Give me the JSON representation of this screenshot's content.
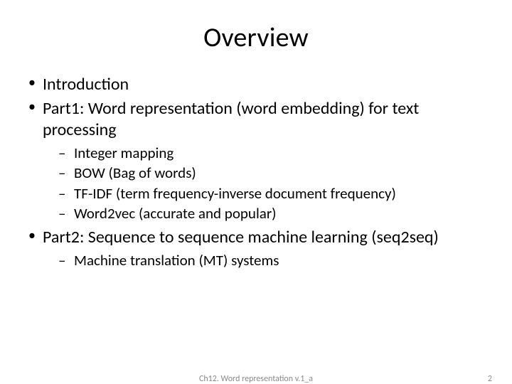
{
  "title": "Overview",
  "bullets": {
    "b1": "Introduction",
    "b2": "Part1: Word representation (word embedding) for text processing",
    "b2sub": {
      "s1": "Integer mapping",
      "s2": "BOW (Bag of words)",
      "s3": "TF-IDF (term frequency-inverse document frequency)",
      "s4": "Word2vec (accurate and popular)"
    },
    "b3": "Part2: Sequence to sequence machine learning (seq2seq)",
    "b3sub": {
      "s1": "Machine translation (MT) systems"
    }
  },
  "footer": {
    "center": "Ch12. Word representation v.1_a",
    "page": "2"
  }
}
